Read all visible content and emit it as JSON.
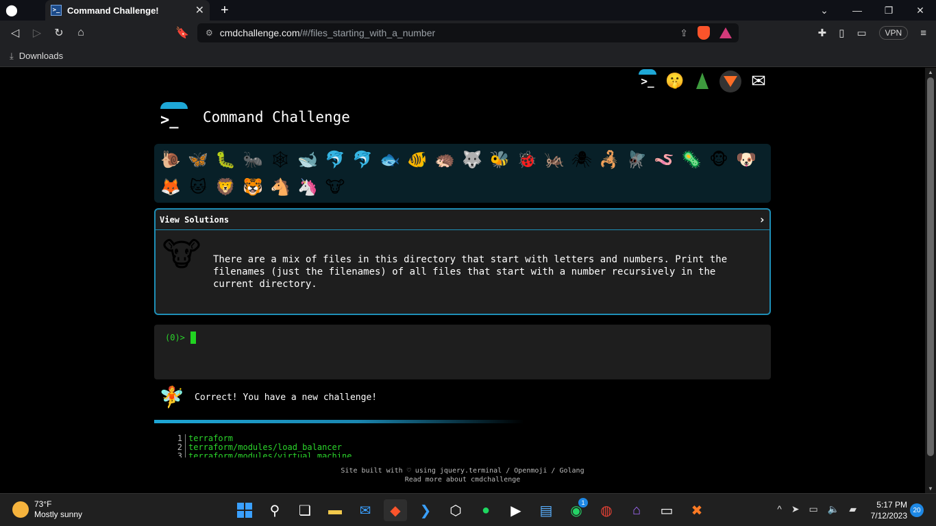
{
  "browser": {
    "tab_title": "Command Challenge!",
    "url_host": "cmdchallenge.com",
    "url_path": "/#/files_starting_with_a_number",
    "vpn_label": "VPN",
    "bookmark_downloads": "Downloads"
  },
  "page": {
    "title": "Command Challenge",
    "view_solutions": "View Solutions",
    "challenge_text": "There are a mix of files in this directory that start with letters and numbers. Print the filenames (just the filenames) of all files that start with a number recursively in the current directory.",
    "prompt": "(0)>",
    "correct_message": "Correct! You have a new challenge!",
    "output_lines": [
      {
        "n": "1",
        "text": "terraform"
      },
      {
        "n": "2",
        "text": "terraform/modules/load_balancer"
      },
      {
        "n": "3",
        "text": "terraform/modules/virtual_machine"
      }
    ],
    "footer_line1": "Site built with ♡ using jquery.terminal / Openmoji / Golang",
    "footer_line2": "Read more about cmdchallenge"
  },
  "animals": [
    "🐌",
    "🦋",
    "🐛",
    "🐜",
    "🕸",
    "🐋",
    "🐬",
    "🐬",
    "🐟",
    "🐠",
    "🦔",
    "🐺",
    "🐝",
    "🐞",
    "🦗",
    "🕷",
    "🦂",
    "🪰",
    "🪱",
    "🦠",
    "🐵",
    "🐶",
    "🦊",
    "🐱",
    "🦁",
    "🐯",
    "🐴",
    "🦄",
    "🐮"
  ],
  "taskbar": {
    "temperature": "73°F",
    "condition": "Mostly sunny",
    "time": "5:17 PM",
    "date": "7/12/2023",
    "notifications": "20",
    "whatsapp_badge": "1"
  }
}
